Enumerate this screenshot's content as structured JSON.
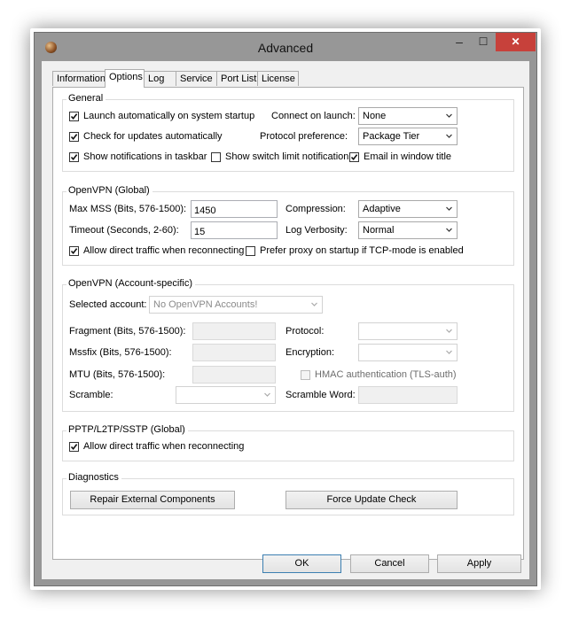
{
  "window": {
    "title": "Advanced",
    "min_glyph": "–",
    "max_glyph": "☐",
    "close_glyph": "✕",
    "close_color": "#c7413b"
  },
  "tabs": [
    "Information",
    "Options",
    "Log",
    "Service",
    "Port List",
    "License"
  ],
  "active_tab": "Options",
  "general": {
    "title": "General",
    "launch_label": "Launch automatically on system startup",
    "launch_checked": true,
    "updates_label": "Check for updates automatically",
    "updates_checked": true,
    "notifications_label": "Show notifications in taskbar",
    "notifications_checked": true,
    "switch_limit_label": "Show switch limit notification",
    "switch_limit_checked": false,
    "email_title_label": "Email in window title",
    "email_title_checked": true,
    "connect_label": "Connect on launch:",
    "connect_value": "None",
    "protocol_label": "Protocol preference:",
    "protocol_value": "Package Tier"
  },
  "openvpn_global": {
    "title": "OpenVPN (Global)",
    "mss_label": "Max MSS (Bits, 576-1500):",
    "mss_value": "1450",
    "timeout_label": "Timeout (Seconds, 2-60):",
    "timeout_value": "15",
    "compression_label": "Compression:",
    "compression_value": "Adaptive",
    "verbosity_label": "Log Verbosity:",
    "verbosity_value": "Normal",
    "direct_label": "Allow direct traffic when reconnecting",
    "direct_checked": true,
    "proxy_label": "Prefer proxy on startup if TCP-mode is enabled",
    "proxy_checked": false
  },
  "openvpn_account": {
    "title": "OpenVPN (Account-specific)",
    "selected_label": "Selected account:",
    "selected_value": "No OpenVPN Accounts!",
    "fragment_label": "Fragment (Bits, 576-1500):",
    "mssfix_label": "Mssfix (Bits, 576-1500):",
    "mtu_label": "MTU (Bits, 576-1500):",
    "scramble_label": "Scramble:",
    "protocol_label": "Protocol:",
    "encryption_label": "Encryption:",
    "hmac_label": "HMAC authentication (TLS-auth)",
    "scramble_word_label": "Scramble Word:"
  },
  "pptp": {
    "title": "PPTP/L2TP/SSTP (Global)",
    "direct_label": "Allow direct traffic when reconnecting",
    "direct_checked": true
  },
  "diagnostics": {
    "title": "Diagnostics",
    "repair_label": "Repair External Components",
    "force_label": "Force Update Check"
  },
  "footer": {
    "ok_label": "OK",
    "cancel_label": "Cancel",
    "apply_label": "Apply"
  }
}
